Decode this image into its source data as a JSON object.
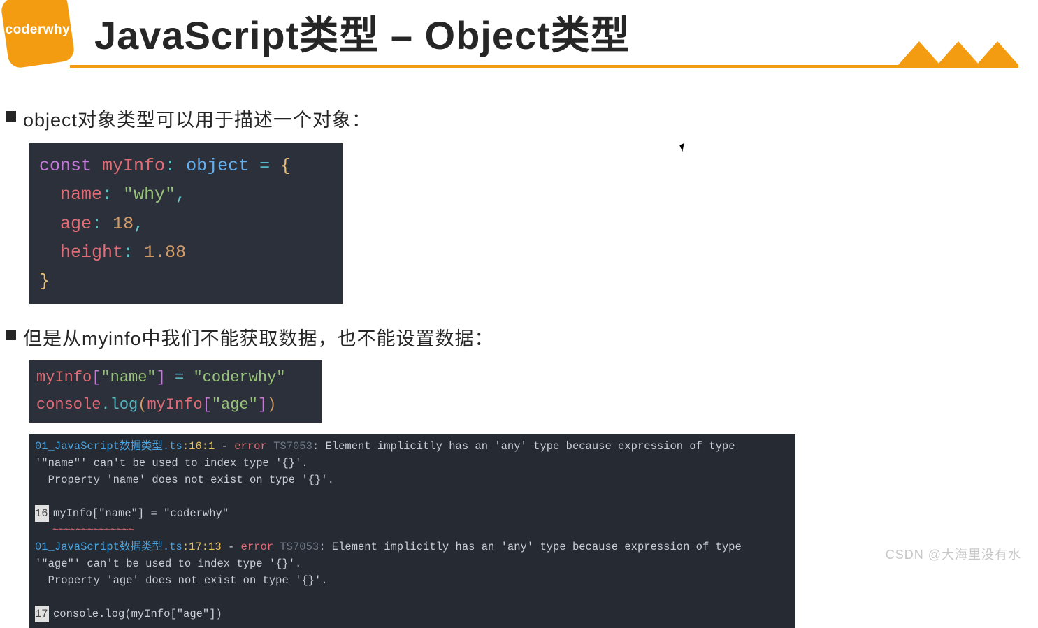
{
  "header": {
    "logo_text": "coderwhy",
    "title": "JavaScript类型 – Object类型"
  },
  "bullet1": "object对象类型可以用于描述一个对象：",
  "code1": {
    "line1": {
      "kw": "const",
      "name": "myInfo",
      "colon": ":",
      "type": "object",
      "eq": "=",
      "brace": "{"
    },
    "line2": {
      "prop": "name",
      "colon": ":",
      "val": "\"why\"",
      "comma": ","
    },
    "line3": {
      "prop": "age",
      "colon": ":",
      "val": "18",
      "comma": ","
    },
    "line4": {
      "prop": "height",
      "colon": ":",
      "val": "1.88"
    },
    "line5": {
      "brace": "}"
    }
  },
  "bullet2": "但是从myinfo中我们不能获取数据，也不能设置数据：",
  "code2": {
    "line1": {
      "obj": "myInfo",
      "lb": "[",
      "key": "\"name\"",
      "rb": "]",
      "eq": " = ",
      "val": "\"coderwhy\""
    },
    "line2": {
      "obj1": "console",
      "dot": ".",
      "fn": "log",
      "lp": "(",
      "obj2": "myInfo",
      "lb": "[",
      "key": "\"age\"",
      "rb": "]",
      "rp": ")"
    }
  },
  "terminal": {
    "err1_file": "01_JavaScript数据类型.ts",
    "err1_loc": ":16:1",
    "err1_sep": " - ",
    "err1_label": "error",
    "err1_code": " TS7053",
    "err1_msg": ": Element implicitly has an 'any' type because expression of type '\"name\"' can't be used to index type '{}'.",
    "err1_detail": "  Property 'name' does not exist on type '{}'.",
    "err1_gutter": "16",
    "err1_src": "myInfo[\"name\"] = \"coderwhy\"",
    "err1_wave": "   ~~~~~~~~~~~~~~",
    "err2_file": "01_JavaScript数据类型.ts",
    "err2_loc": ":17:13",
    "err2_sep": " - ",
    "err2_label": "error",
    "err2_code": " TS7053",
    "err2_msg": ": Element implicitly has an 'any' type because expression of type '\"age\"' can't be used to index type '{}'.",
    "err2_detail": "  Property 'age' does not exist on type '{}'.",
    "err2_gutter": "17",
    "err2_src": "console.log(myInfo[\"age\"])"
  },
  "watermark": "CSDN @大海里没有水"
}
